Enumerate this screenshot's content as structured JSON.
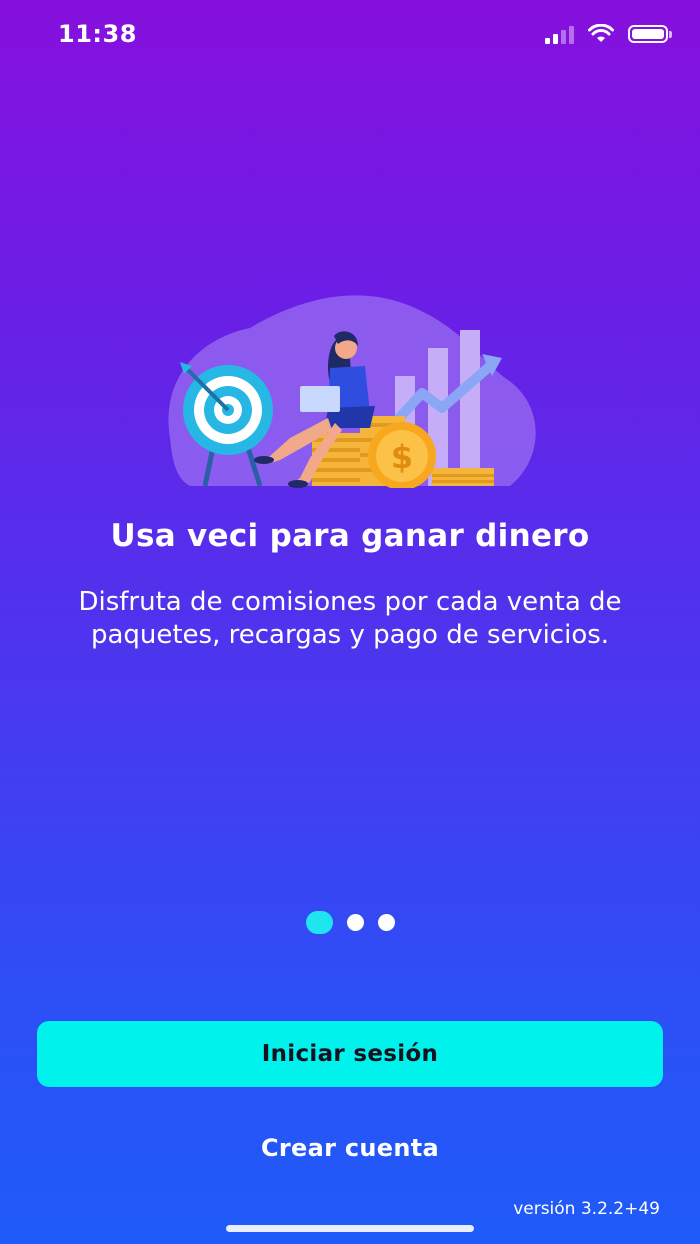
{
  "status_bar": {
    "time": "11:38"
  },
  "onboarding": {
    "title": "Usa veci para ganar dinero",
    "description": "Disfruta de comisiones por cada venta de paquetes, recargas y pago de servicios.",
    "pages_total": 3,
    "active_page": 1
  },
  "actions": {
    "login_label": "Iniciar sesión",
    "create_account_label": "Crear cuenta"
  },
  "footer": {
    "version": "versión 3.2.2+49"
  },
  "colors": {
    "background_top": "#8710de",
    "background_bottom": "#1f5bf8",
    "accent": "#00f2ec",
    "active_dot": "#1ee5f0"
  },
  "icons": [
    "signal-icon",
    "wifi-icon",
    "battery-icon",
    "target-icon",
    "dollar-coin-icon",
    "trend-arrow-icon"
  ]
}
